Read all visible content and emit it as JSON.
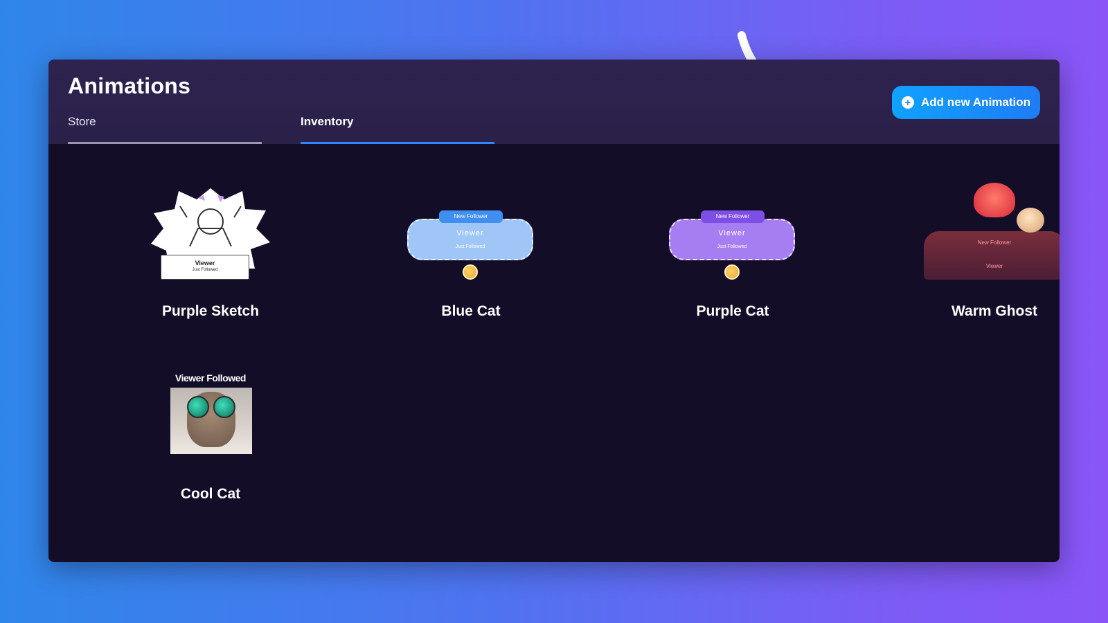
{
  "header": {
    "title": "Animations",
    "tabs": [
      {
        "label": "Store",
        "active": false
      },
      {
        "label": "Inventory",
        "active": true
      }
    ],
    "add_button_label": "Add new Animation",
    "accent_color": "#2f86ff"
  },
  "cards": [
    {
      "name": "Purple Sketch",
      "preview": {
        "viewer": "Viewer",
        "sub": "Just Followed"
      }
    },
    {
      "name": "Blue Cat",
      "preview": {
        "tag": "New Follower",
        "viewer": "Viewer",
        "sub": "Just Followed",
        "color": "#9fc6f7"
      }
    },
    {
      "name": "Purple Cat",
      "preview": {
        "tag": "New Follower",
        "viewer": "Viewer",
        "sub": "Just Followed",
        "color": "#a77df2"
      }
    },
    {
      "name": "Warm Ghost",
      "preview": {
        "tag": "New Follower",
        "viewer": "Viewer"
      }
    },
    {
      "name": "Cool Cat",
      "preview": {
        "title": "Viewer Followed"
      }
    }
  ],
  "icons": {
    "add": "plus-circle-icon",
    "annotation": "curved-arrow-icon"
  }
}
